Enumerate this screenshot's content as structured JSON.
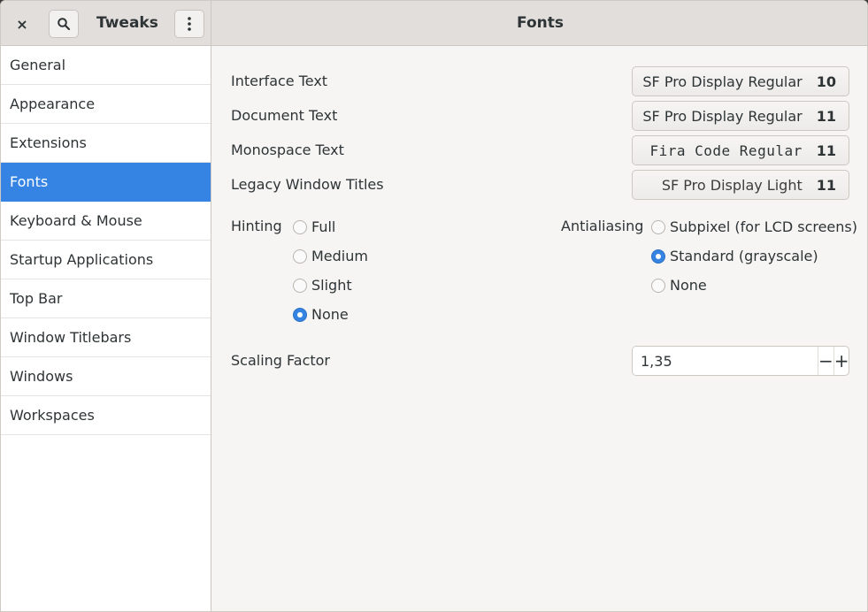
{
  "header": {
    "app_title": "Tweaks",
    "page_title": "Fonts",
    "close_symbol": "×",
    "menu_symbol": "⋮"
  },
  "sidebar": {
    "items": [
      {
        "label": "General"
      },
      {
        "label": "Appearance"
      },
      {
        "label": "Extensions"
      },
      {
        "label": "Fonts"
      },
      {
        "label": "Keyboard & Mouse"
      },
      {
        "label": "Startup Applications"
      },
      {
        "label": "Top Bar"
      },
      {
        "label": "Window Titlebars"
      },
      {
        "label": "Windows"
      },
      {
        "label": "Workspaces"
      }
    ],
    "active_index": 3,
    "active_color": "#3584e4"
  },
  "fonts": {
    "interface": {
      "label": "Interface Text",
      "font": "SF Pro Display Regular",
      "size": "10"
    },
    "document": {
      "label": "Document Text",
      "font": "SF Pro Display Regular",
      "size": "11"
    },
    "monospace": {
      "label": "Monospace Text",
      "font": "Fira Code Regular",
      "size": "11"
    },
    "legacy": {
      "label": "Legacy Window Titles",
      "font": "SF Pro Display Light",
      "size": "11"
    }
  },
  "hinting": {
    "label": "Hinting",
    "options": [
      "Full",
      "Medium",
      "Slight",
      "None"
    ],
    "selected": "None"
  },
  "antialiasing": {
    "label": "Antialiasing",
    "options": [
      "Subpixel (for LCD screens)",
      "Standard (grayscale)",
      "None"
    ],
    "selected": "Standard (grayscale)"
  },
  "scaling": {
    "label": "Scaling Factor",
    "value": "1,35",
    "minus": "−",
    "plus": "+"
  }
}
